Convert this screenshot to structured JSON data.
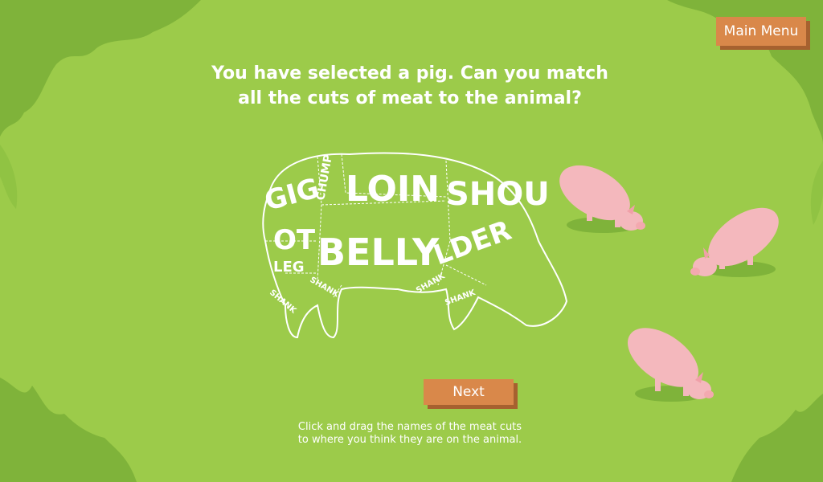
{
  "title_line1": "You have selected a pig. Can you match",
  "title_line2": "all the cuts of meat to the animal?",
  "main_menu_label": "Main Menu",
  "next_label": "Next",
  "instruction_line1": "Click and drag the names of the meat cuts",
  "instruction_line2": "to where you think they are on the animal.",
  "cuts": {
    "gigot": "GIG",
    "gigot2": "OT",
    "chump": "CHUMP",
    "loin": "LOIN",
    "shoulder": "SHOU",
    "shoulder2": "LDER",
    "belly": "BELLY",
    "leg": "LEG",
    "shank1": "SHANK",
    "shank2": "SHANK",
    "shank3": "SHANK",
    "shank4": "SHANK"
  },
  "colors": {
    "background": "#9ccb4a",
    "grass_dark": "#7fb33a",
    "button": "#d9884a",
    "pig": "#f4b8bd"
  }
}
